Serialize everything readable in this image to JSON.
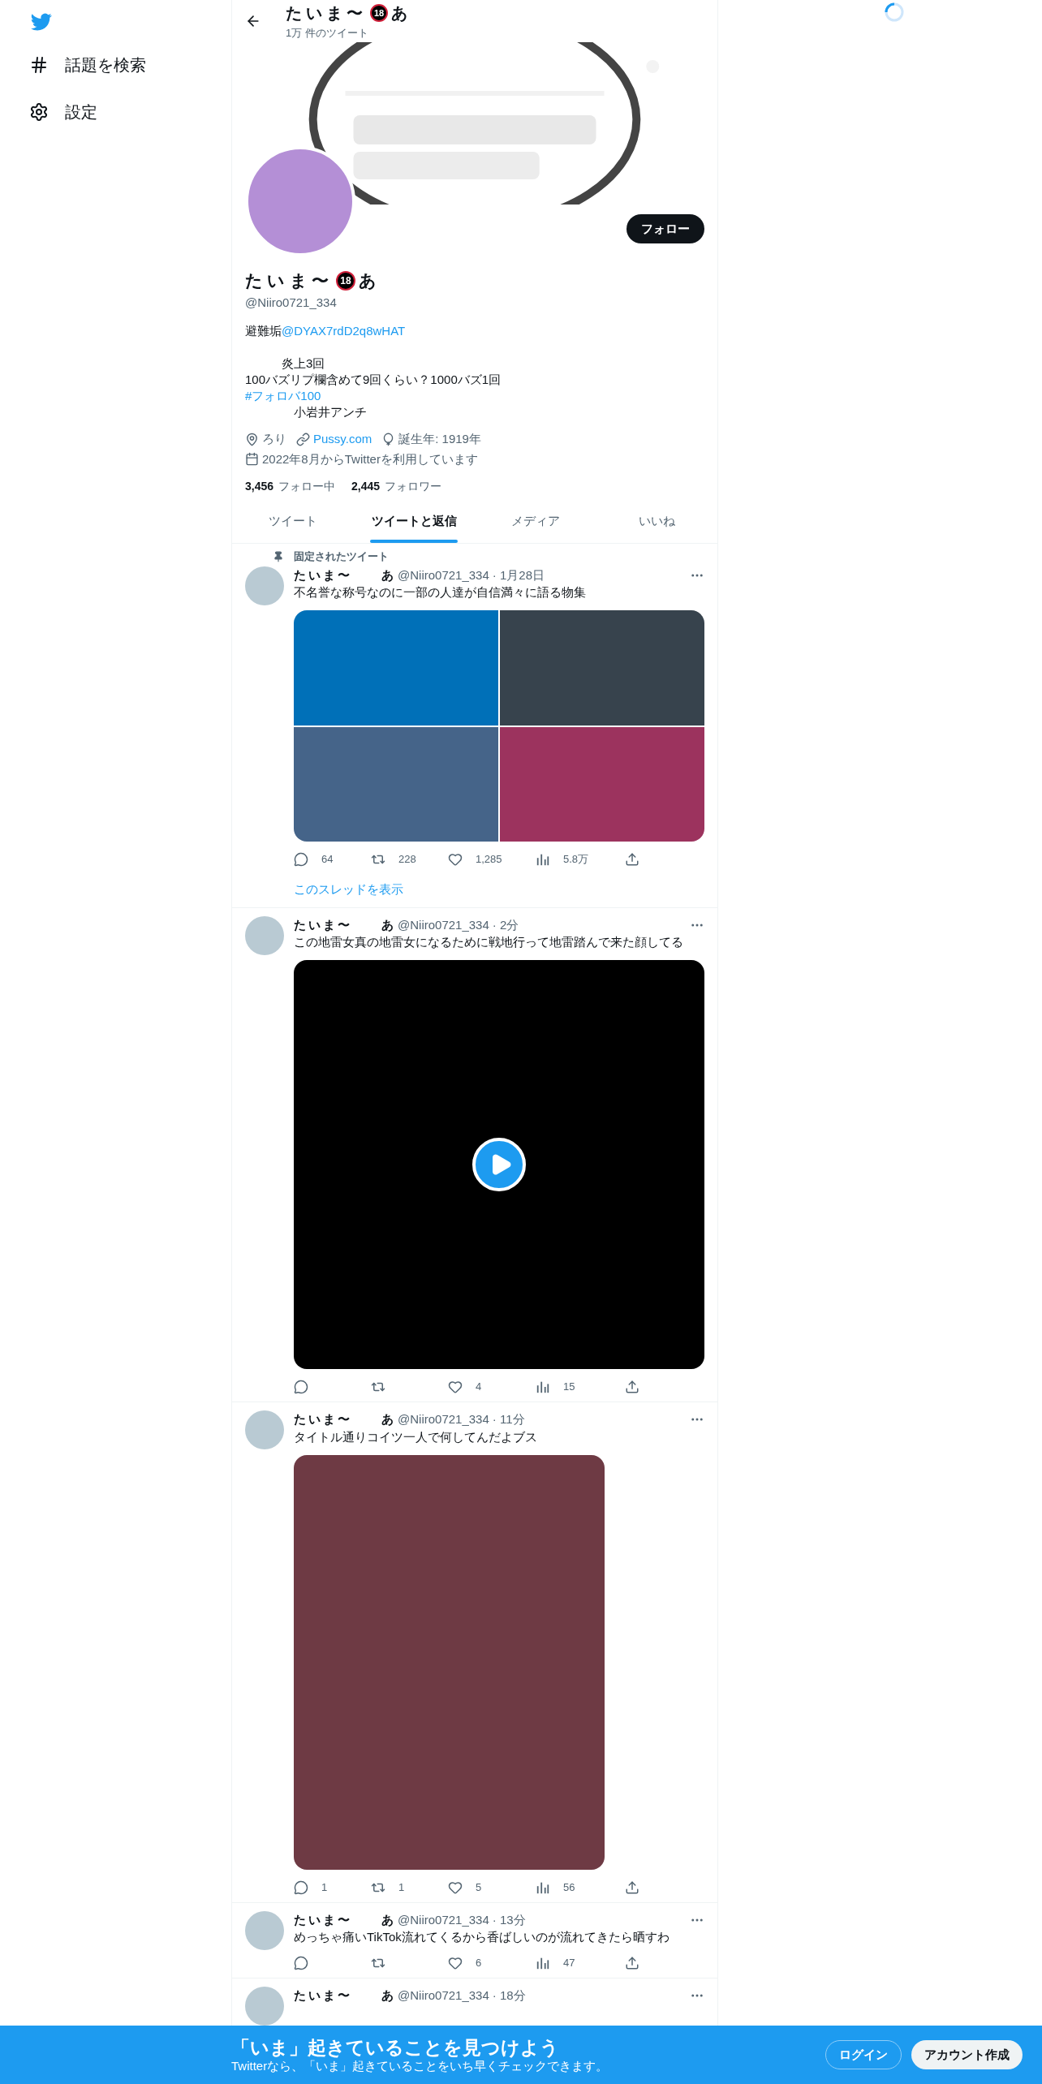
{
  "sidebar": {
    "items": [
      {
        "kind": "explore",
        "label": "話題を検索"
      },
      {
        "kind": "settings",
        "label": "設定"
      }
    ]
  },
  "header": {
    "name": "たいま〜",
    "badge": "18",
    "name_tail": "あ",
    "tweet_count": "1万 件のツイート"
  },
  "profile": {
    "follow_button": "フォロー",
    "name": "たいま〜",
    "badge": "18",
    "name_tail": "あ",
    "handle": "@Niiro0721_334",
    "bio": [
      [
        [
          {
            "text": "避難垢",
            "link": false
          },
          {
            "text": "@DYAX7rdD2q8wHAT",
            "link": true
          }
        ]
      ],
      [
        [
          {
            "text": "　　　炎上3回",
            "link": false
          }
        ],
        [
          {
            "text": "100バズリプ欄含めて9回くらい？1000バズ1回",
            "link": false
          }
        ],
        [
          {
            "text": "#フォロバ100",
            "link": true
          }
        ],
        [
          {
            "text": "　　　　小岩井アンチ",
            "link": false
          }
        ]
      ]
    ],
    "meta": [
      {
        "kind": "location",
        "text": "ろり",
        "link": false
      },
      {
        "kind": "url",
        "text": "Pussy.com",
        "link": true
      },
      {
        "kind": "birthday",
        "text": "誕生年: 1919年",
        "link": false
      },
      {
        "kind": "joined",
        "text": "2022年8月からTwitterを利用しています",
        "link": false
      }
    ],
    "following": {
      "count": "3,456",
      "label": "フォロー中"
    },
    "followers": {
      "count": "2,445",
      "label": "フォロワー"
    }
  },
  "tabs": [
    {
      "label": "ツイート",
      "selected": false
    },
    {
      "label": "ツイートと返信",
      "selected": true
    },
    {
      "label": "メディア",
      "selected": false
    },
    {
      "label": "いいね",
      "selected": false
    }
  ],
  "tweets": [
    {
      "pinned_label": "固定されたツイート",
      "name": "たいま〜　　あ",
      "handle": "@Niiro0721_334",
      "time": "· 1月28日",
      "text": "不名誉な称号なのに一部の人達が自信満々に語る物集",
      "media": {
        "kind": "grid",
        "items": [
          {
            "color": "#0070b8"
          },
          {
            "color": "#37434d"
          },
          {
            "color": "#456489"
          },
          {
            "color": "#9c335e"
          }
        ]
      },
      "actions": [
        {
          "kind": "reply",
          "count": "64"
        },
        {
          "kind": "retweet",
          "count": "228"
        },
        {
          "kind": "like",
          "count": "1,285"
        },
        {
          "kind": "views",
          "count": "5.8万"
        },
        {
          "kind": "share"
        }
      ],
      "thread_link": "このスレッドを表示"
    },
    {
      "name": "たいま〜　　あ",
      "handle": "@Niiro0721_334",
      "time": "· 2分",
      "text": "この地雷女真の地雷女になるために戦地行って地雷踏んで来た顔してる",
      "media": {
        "kind": "video"
      },
      "actions": [
        {
          "kind": "reply"
        },
        {
          "kind": "retweet"
        },
        {
          "kind": "like",
          "count": "4"
        },
        {
          "kind": "views",
          "count": "15"
        },
        {
          "kind": "share"
        }
      ]
    },
    {
      "name": "たいま〜　　あ",
      "handle": "@Niiro0721_334",
      "time": "· 11分",
      "text": "タイトル通りコイツ一人で何してんだよブス",
      "actions": [
        {
          "kind": "reply",
          "count": "1"
        },
        {
          "kind": "retweet",
          "count": "1"
        },
        {
          "kind": "like",
          "count": "5"
        },
        {
          "kind": "views",
          "count": "56"
        },
        {
          "kind": "share"
        }
      ]
    },
    {
      "name": "たいま〜　　あ",
      "handle": "@Niiro0721_334",
      "time": "· 13分",
      "text": "めっちゃ痛いTikTok流れてくるから香ばしいのが流れてきたら晒すわ",
      "actions": [
        {
          "kind": "reply"
        },
        {
          "kind": "retweet"
        },
        {
          "kind": "like",
          "count": "6"
        },
        {
          "kind": "views",
          "count": "47"
        },
        {
          "kind": "share"
        }
      ]
    },
    {
      "name": "たいま〜　　あ",
      "handle": "@Niiro0721_334",
      "time": "· 18分"
    }
  ],
  "signup_bar": {
    "title": "「いま」起きていることを見つけよう",
    "subtitle": "Twitterなら、「いま」起きていることをいち早くチェックできます。",
    "login": "ログイン",
    "signup": "アカウント作成"
  }
}
